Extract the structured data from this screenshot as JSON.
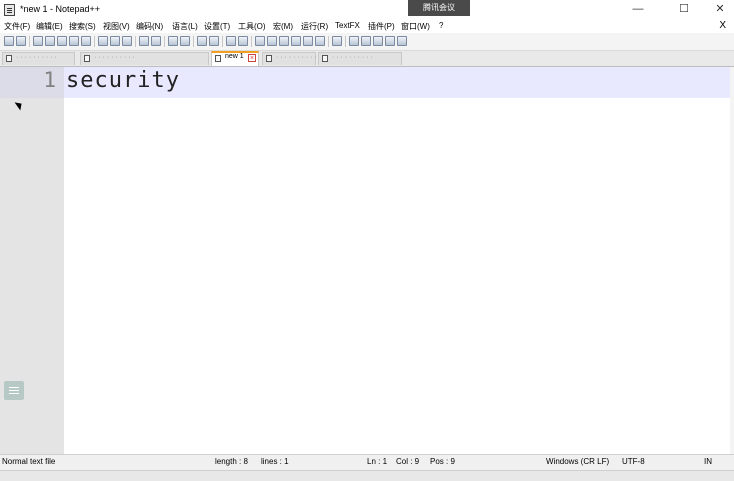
{
  "window": {
    "title": "*new 1 - Notepad++",
    "meeting_tag": "腾讯会议",
    "minimize_label": "—",
    "maximize_label": "☐",
    "close_label": "✕"
  },
  "menu": {
    "items": [
      "文件(F)",
      "编辑(E)",
      "搜索(S)",
      "视图(V)",
      "编码(N)",
      "语言(L)",
      "设置(T)",
      "工具(O)",
      "宏(M)",
      "运行(R)",
      "TextFX",
      "插件(P)",
      "窗口(W)",
      "?"
    ],
    "close_doc": "X"
  },
  "toolbar": {
    "buttons": [
      "new-file-icon",
      "open-file-icon",
      "save-icon",
      "save-all-icon",
      "close-icon",
      "close-all-icon",
      "print-icon",
      "cut-icon",
      "copy-icon",
      "paste-icon",
      "undo-icon",
      "redo-icon",
      "find-icon",
      "replace-icon",
      "zoom-in-icon",
      "zoom-out-icon",
      "sync-vertical-icon",
      "sync-horizontal-icon",
      "word-wrap-icon",
      "show-all-chars-icon",
      "indent-guide-icon",
      "doc-map-icon",
      "function-list-icon",
      "folder-workspace-icon",
      "monitor-icon",
      "record-macro-icon",
      "stop-macro-icon",
      "play-macro-icon",
      "run-macro-icon",
      "save-macro-icon"
    ]
  },
  "tabs": [
    {
      "label": "· · · · · · · · · ·",
      "active": false
    },
    {
      "label": "· · · · · · · · · ·",
      "active": false
    },
    {
      "label": "new 1",
      "active": true
    },
    {
      "label": "· · · · · · · · · ·",
      "active": false
    },
    {
      "label": "· · · · · · · · · ·",
      "active": false
    },
    {
      "label": "· · · · · · · · · ·",
      "active": false
    }
  ],
  "editor": {
    "line_number": "1",
    "line_text": "security"
  },
  "status": {
    "file_type": "Normal text file",
    "length": "length : 8",
    "lines": "lines : 1",
    "ln": "Ln : 1",
    "col": "Col : 9",
    "pos": "Pos : 9",
    "eol": "Windows (CR LF)",
    "encoding": "UTF-8",
    "mode": "IN"
  }
}
